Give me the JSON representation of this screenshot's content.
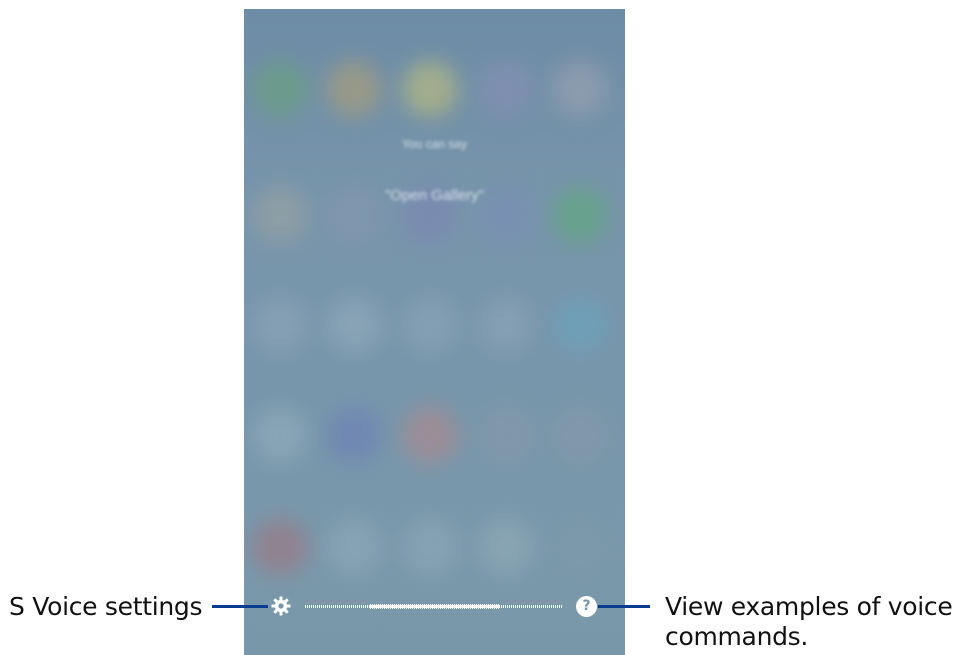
{
  "screen": {
    "hint_line_1": "You can say",
    "hint_line_2": "\"Open Gallery\"",
    "gear_icon": "gear-icon",
    "help_icon": "question-circle-icon",
    "help_glyph": "?"
  },
  "callouts": {
    "settings_label": "S Voice settings",
    "examples_label_line1": "View examples of voice",
    "examples_label_line2": "commands."
  },
  "colors": {
    "screen_background": "#7895ab",
    "callout_line": "#0a3d91",
    "label_text": "#111111"
  }
}
